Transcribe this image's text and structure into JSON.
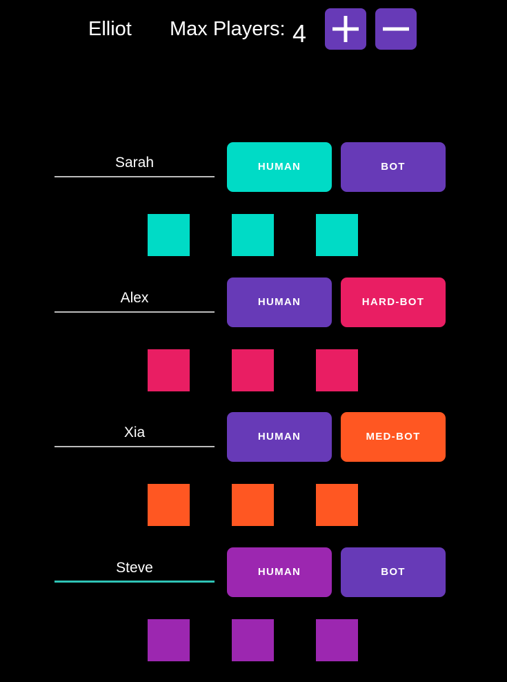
{
  "header": {
    "host_name": "Elliot",
    "max_players_label": "Max Players:",
    "max_players_value": "4",
    "add_icon": "plus-icon",
    "remove_icon": "minus-icon"
  },
  "colors": {
    "accent_purple": "#673ab7",
    "teal": "#00dbc6",
    "pink": "#e91e63",
    "orange": "#ff5722",
    "magenta": "#9c27b0",
    "focus_underline": "#2ec4b6"
  },
  "players": [
    {
      "name": "Sarah",
      "human_label": "HUMAN",
      "bot_label": "BOT",
      "human_color": "#00dbc6",
      "bot_color": "#673ab7",
      "player_color": "#00dbc6"
    },
    {
      "name": "Alex",
      "human_label": "HUMAN",
      "bot_label": "HARD-BOT",
      "human_color": "#673ab7",
      "bot_color": "#e91e63",
      "player_color": "#e91e63"
    },
    {
      "name": "Xia",
      "human_label": "HUMAN",
      "bot_label": "MED-BOT",
      "human_color": "#673ab7",
      "bot_color": "#ff5722",
      "player_color": "#ff5722"
    },
    {
      "name": "Steve",
      "human_label": "HUMAN",
      "bot_label": "BOT",
      "human_color": "#9c27b0",
      "bot_color": "#673ab7",
      "player_color": "#9c27b0"
    }
  ]
}
